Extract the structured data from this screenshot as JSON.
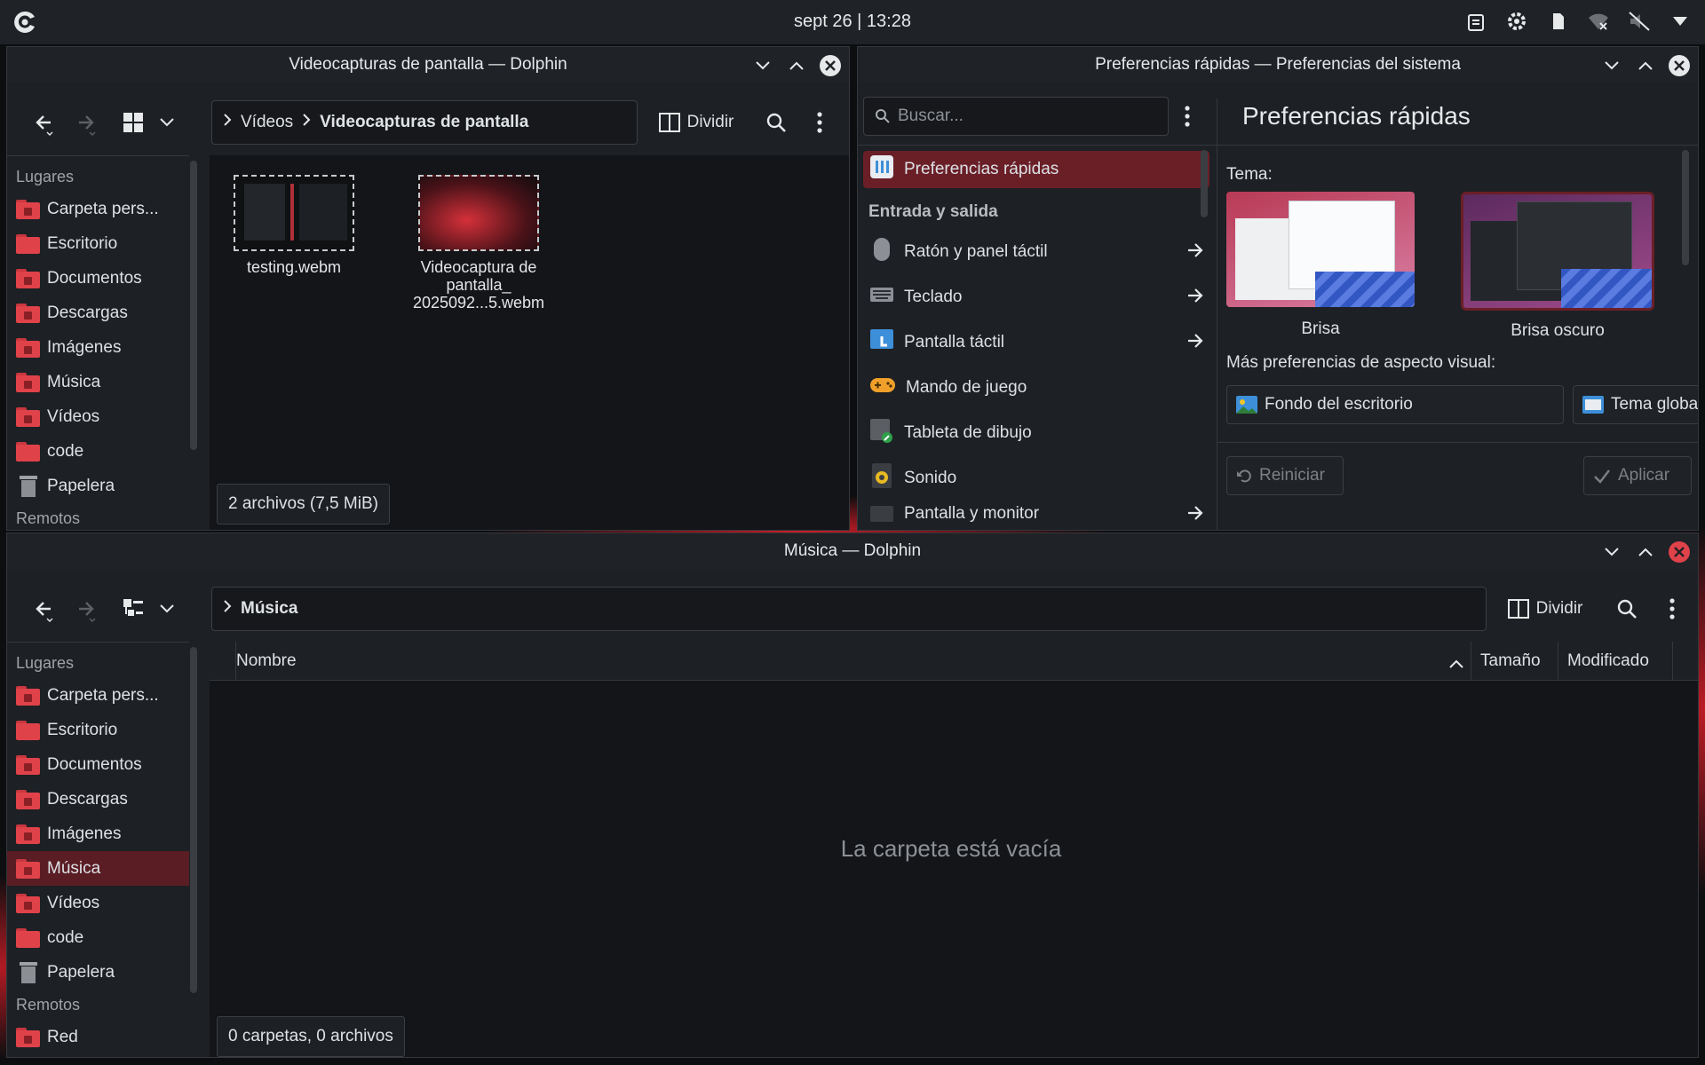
{
  "topbar": {
    "clock": "sept 26 | 13:28"
  },
  "places_labels": {
    "section_places": "Lugares",
    "section_remote": "Remotos"
  },
  "places": [
    {
      "label": "Carpeta pers..."
    },
    {
      "label": "Escritorio"
    },
    {
      "label": "Documentos"
    },
    {
      "label": "Descargas"
    },
    {
      "label": "Imágenes"
    },
    {
      "label": "Música"
    },
    {
      "label": "Vídeos"
    },
    {
      "label": "code"
    },
    {
      "label": "Papelera"
    }
  ],
  "win1": {
    "title": "Videocapturas de pantalla — Dolphin",
    "crumb_parent": "Vídeos",
    "crumb_current": "Videocapturas de pantalla",
    "split_label": "Dividir",
    "files": [
      {
        "name": "testing.webm"
      },
      {
        "name": "Videocaptura de pantalla_ 2025092...5.webm"
      }
    ],
    "status": "2 archivos (7,5 MiB)"
  },
  "win2": {
    "title": "Preferencias rápidas — Preferencias del sistema",
    "search_placeholder": "Buscar...",
    "heading": "Preferencias rápidas",
    "selected_item": "Preferencias rápidas",
    "section": "Entrada y salida",
    "items": [
      {
        "label": "Ratón y panel táctil",
        "arrow": true
      },
      {
        "label": "Teclado",
        "arrow": true
      },
      {
        "label": "Pantalla táctil",
        "arrow": true
      },
      {
        "label": "Mando de juego",
        "arrow": false
      },
      {
        "label": "Tableta de dibujo",
        "arrow": false
      },
      {
        "label": "Sonido",
        "arrow": false
      },
      {
        "label": "Pantalla y monitor",
        "arrow": true
      }
    ],
    "theme_label": "Tema:",
    "themes": [
      {
        "label": "Brisa"
      },
      {
        "label": "Brisa oscuro"
      }
    ],
    "more_label": "Más preferencias de aspecto visual:",
    "wallpaper_btn": "Fondo del escritorio",
    "global_theme_btn": "Tema global",
    "reset_btn": "Reiniciar",
    "apply_btn": "Aplicar"
  },
  "win3": {
    "title": "Música — Dolphin",
    "crumb_current": "Música",
    "split_label": "Dividir",
    "columns": {
      "name": "Nombre",
      "size": "Tamaño",
      "modified": "Modificado"
    },
    "empty_text": "La carpeta está vacía",
    "status": "0 carpetas, 0 archivos",
    "remote_item": "Red"
  },
  "colors": {
    "accent": "#e0424a",
    "selection": "#5a1d24",
    "bg": "#1d2024"
  }
}
